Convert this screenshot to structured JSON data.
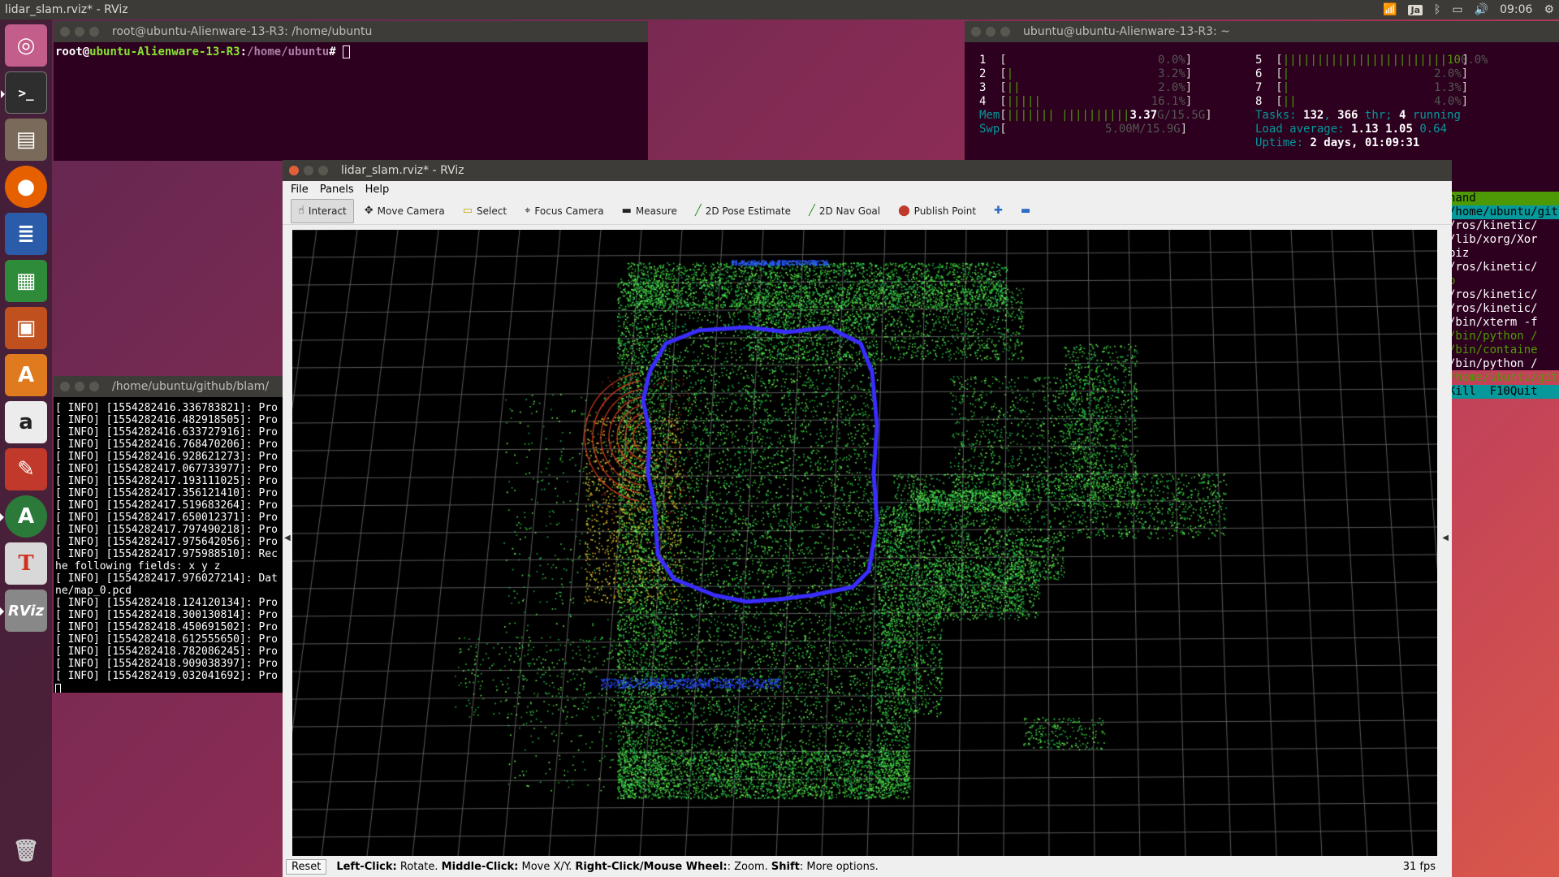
{
  "top_panel": {
    "title": "lidar_slam.rviz* - RViz",
    "keyboard": "Ja",
    "clock": "09:06"
  },
  "launcher": {
    "items": [
      "ubuntu-icon",
      "terminal-icon",
      "files-icon",
      "firefox-icon",
      "writer-icon",
      "calc-icon",
      "impress-icon",
      "software-center-icon",
      "amazon-icon",
      "settings-icon",
      "updater-icon",
      "texmaker-icon",
      "rviz-icon"
    ],
    "rviz_label": "RViz"
  },
  "term_root": {
    "title": "root@ubuntu-Alienware-13-R3: /home/ubuntu",
    "prompt_user": "root@",
    "prompt_host": "ubuntu-Alienware-13-R3",
    "prompt_sep": ":",
    "prompt_path": "/home/ubuntu",
    "prompt_char": "# "
  },
  "htop": {
    "title": "ubuntu@ubuntu-Alienware-13-R3: ~",
    "cpus": [
      {
        "n": "1",
        "bars": "",
        "pct": "0.0%"
      },
      {
        "n": "2",
        "bars": "|",
        "pct": "3.2%"
      },
      {
        "n": "3",
        "bars": "||",
        "pct": "2.0%"
      },
      {
        "n": "4",
        "bars": "|||||",
        "pct": "16.1%"
      },
      {
        "n": "5",
        "bars": "||||||||||||||||||||||||10",
        "pct": "0.0%"
      },
      {
        "n": "6",
        "bars": "|",
        "pct": "2.0%"
      },
      {
        "n": "7",
        "bars": "|",
        "pct": "1.3%"
      },
      {
        "n": "8",
        "bars": "||",
        "pct": "4.0%"
      }
    ],
    "mem_label": "Mem",
    "mem_bars": "||||||| ||||||||||",
    "mem_value": "3.37",
    "mem_total": "G/15.5G",
    "swp_label": "Swp",
    "swp_value": "5.00M/15.9G",
    "tasks_label": "Tasks: ",
    "tasks_count": "132",
    "tasks_thr_sep": ", ",
    "threads": "366",
    "thr_label": " thr; ",
    "running": "4",
    "running_label": " running",
    "load_label": "Load average: ",
    "load1": "1.13",
    "load5": "1.05",
    "load15": "0.64",
    "uptime_label": "Uptime: ",
    "uptime": "2 days, 01:09:31",
    "cmd_rows": [
      {
        "text": "hand",
        "style": "hdr"
      },
      {
        "text": "/home/ubuntu/gith",
        "style": "sel"
      },
      {
        "text": "/ros/kinetic/",
        "style": "plain"
      },
      {
        "text": "/lib/xorg/Xor",
        "style": "plain"
      },
      {
        "text": "piz",
        "style": "plain"
      },
      {
        "text": "/ros/kinetic/",
        "style": "plain"
      },
      {
        "text": "o",
        "style": "green"
      },
      {
        "text": "/ros/kinetic/",
        "style": "plain"
      },
      {
        "text": "/ros/kinetic/",
        "style": "plain"
      },
      {
        "text": "/bin/xterm -f",
        "style": "plain"
      },
      {
        "text": "/bin/python /",
        "style": "green"
      },
      {
        "text": "/bin/containe",
        "style": "green"
      },
      {
        "text": "/bin/python /",
        "style": "plain"
      },
      {
        "text": "/home/ubuntu/gith",
        "style": "green"
      },
      {
        "text": "Kill  F10Quit",
        "style": "sel"
      }
    ]
  },
  "term_log": {
    "title": "/home/ubuntu/github/blam/",
    "lines": [
      "[ INFO] [1554282416.336783821]: Pro",
      "[ INFO] [1554282416.482918505]: Pro",
      "[ INFO] [1554282416.633727916]: Pro",
      "[ INFO] [1554282416.768470206]: Pro",
      "[ INFO] [1554282416.928621273]: Pro",
      "[ INFO] [1554282417.067733977]: Pro",
      "[ INFO] [1554282417.193111025]: Pro",
      "[ INFO] [1554282417.356121410]: Pro",
      "[ INFO] [1554282417.519683264]: Pro",
      "[ INFO] [1554282417.650012371]: Pro",
      "[ INFO] [1554282417.797490218]: Pro",
      "[ INFO] [1554282417.975642056]: Pro",
      "[ INFO] [1554282417.975988510]: Rec",
      "he following fields: x y z",
      "[ INFO] [1554282417.976027214]: Dat",
      "ne/map_0.pcd",
      "[ INFO] [1554282418.124120134]: Pro",
      "[ INFO] [1554282418.300130814]: Pro",
      "[ INFO] [1554282418.450691502]: Pro",
      "[ INFO] [1554282418.612555650]: Pro",
      "[ INFO] [1554282418.782086245]: Pro",
      "[ INFO] [1554282418.909038397]: Pro",
      "[ INFO] [1554282419.032041692]: Pro"
    ]
  },
  "rviz": {
    "title": "lidar_slam.rviz* - RViz",
    "menu": [
      "File",
      "Panels",
      "Help"
    ],
    "tools": [
      {
        "label": "Interact",
        "icon": "hand-icon",
        "active": true
      },
      {
        "label": "Move Camera",
        "icon": "move-camera-icon",
        "active": false
      },
      {
        "label": "Select",
        "icon": "select-icon",
        "active": false
      },
      {
        "label": "Focus Camera",
        "icon": "focus-camera-icon",
        "active": false
      },
      {
        "label": "Measure",
        "icon": "measure-icon",
        "active": false
      },
      {
        "label": "2D Pose Estimate",
        "icon": "pose-estimate-icon",
        "active": false
      },
      {
        "label": "2D Nav Goal",
        "icon": "nav-goal-icon",
        "active": false
      },
      {
        "label": "Publish Point",
        "icon": "publish-point-icon",
        "active": false
      }
    ],
    "status": {
      "reset": "Reset",
      "l1": "Left-Click:",
      "t1": " Rotate. ",
      "l2": "Middle-Click:",
      "t2": " Move X/Y. ",
      "l3": "Right-Click/Mouse Wheel:",
      "t3": ": Zoom. ",
      "l4": "Shift",
      "t4": ": More options."
    },
    "fps": "31 fps"
  },
  "colors": {
    "point_cloud": "#33cc33",
    "trajectory": "#3a2cff",
    "scan": "#d63a1e",
    "grid": "#5a5a5a"
  }
}
